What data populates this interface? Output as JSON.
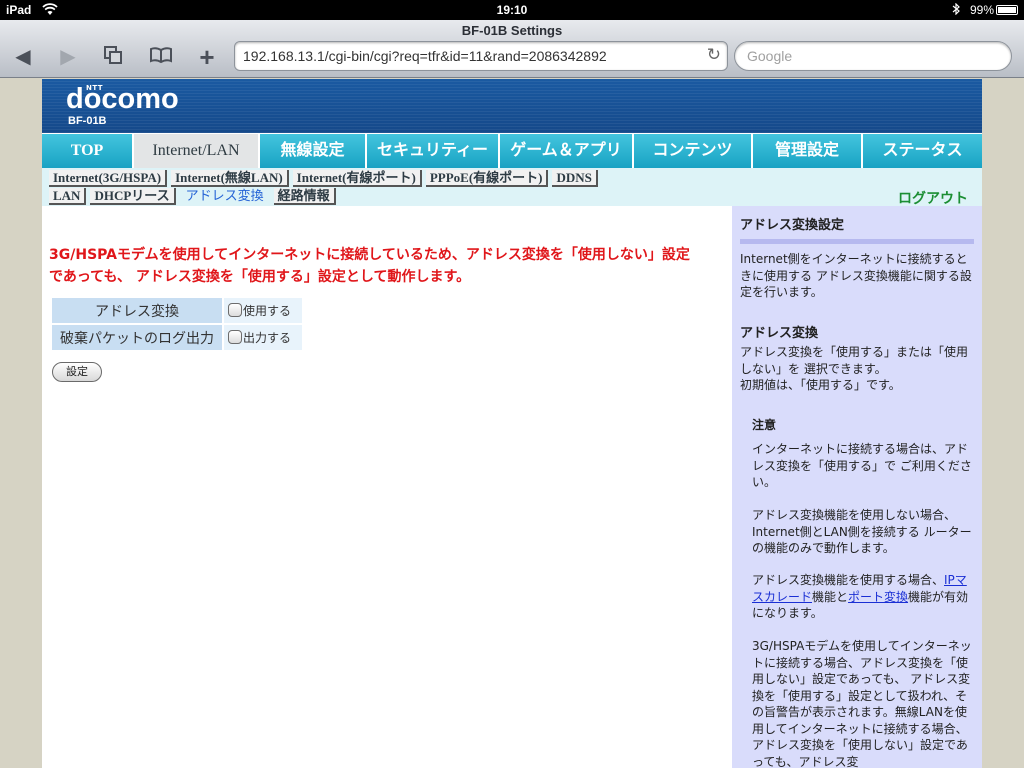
{
  "status_bar": {
    "device": "iPad",
    "time": "19:10",
    "battery": "99%"
  },
  "browser": {
    "title": "BF-01B Settings",
    "url": "192.168.13.1/cgi-bin/cgi?req=tfr&id=11&rand=2086342892",
    "search_placeholder": "Google"
  },
  "header": {
    "brand": "docomo",
    "brand_small": "NTT",
    "model": "BF-01B"
  },
  "main_nav": [
    {
      "label": "TOP"
    },
    {
      "label": "Internet/LAN"
    },
    {
      "label": "無線設定"
    },
    {
      "label": "セキュリティー"
    },
    {
      "label": "ゲーム＆アプリ"
    },
    {
      "label": "コンテンツ"
    },
    {
      "label": "管理設定"
    },
    {
      "label": "ステータス"
    }
  ],
  "sub_nav": {
    "row1": [
      "Internet(3G/HSPA)",
      "Internet(無線LAN)",
      "Internet(有線ポート)",
      "PPPoE(有線ポート)",
      "DDNS"
    ],
    "row2": [
      "LAN",
      "DHCPリース",
      "アドレス変換",
      "経路情報"
    ],
    "logout": "ログアウト"
  },
  "content": {
    "warning": "3G/HSPAモデムを使用してインターネットに接続しているため、アドレス変換を「使用しない」設定であっても、 アドレス変換を「使用する」設定として動作します。",
    "rows": [
      {
        "label": "アドレス変換",
        "option": "使用する"
      },
      {
        "label": "破棄パケットのログ出力",
        "option": "出力する"
      }
    ],
    "submit": "設定"
  },
  "help": {
    "title": "アドレス変換設定",
    "intro": "Internet側をインターネットに接続するときに使用する アドレス変換機能に関する設定を行います。",
    "section_title": "アドレス変換",
    "section_body_1": "アドレス変換を「使用する」または「使用しない」を 選択できます。",
    "section_body_2": "初期値は、「使用する」です。",
    "note_title": "注意",
    "note_1": "インターネットに接続する場合は、アドレス変換を「使用する」で ご利用ください。",
    "note_2": "アドレス変換機能を使用しない場合、Internet側とLAN側を接続する ルーターの機能のみで動作します。",
    "note_3_a": "アドレス変換機能を使用する場合、",
    "note_3_link1": "IPマスカレード",
    "note_3_b": "機能と",
    "note_3_link2": "ポート変換",
    "note_3_c": "機能が有効になります。",
    "note_4": "3G/HSPAモデムを使用してインターネットに接続する場合、アドレス変換を「使用しない」設定であっても、 アドレス変換を「使用する」設定として扱われ、その旨警告が表示されます。無線LANを使用してインターネットに接続する場合、アドレス変換を「使用しない」設定であっても、アドレス変"
  },
  "colors": {
    "header_blue": "#15498a",
    "nav_cyan": "#1ea7c8",
    "warning_red": "#e0161a",
    "help_bg": "#d9dcfb",
    "logout_green": "#1b8e33"
  }
}
